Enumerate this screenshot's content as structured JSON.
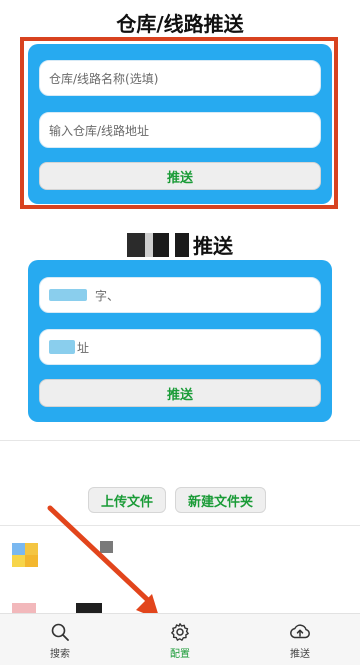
{
  "section1": {
    "title": "仓库/线路推送",
    "name_placeholder": "仓库/线路名称(选填)",
    "address_placeholder": "输入仓库/线路地址",
    "push_label": "推送"
  },
  "section2": {
    "title": "推送",
    "field1_text": "字、",
    "field2_text": "址",
    "push_label": "推送"
  },
  "file_actions": {
    "upload_label": "上传文件",
    "new_folder_label": "新建文件夹"
  },
  "bottom_nav": {
    "search_label": "搜索",
    "config_label": "配置",
    "push_label": "推送"
  },
  "colors": {
    "card_blue": "#27aaf0",
    "highlight_red": "#d8421f",
    "action_green": "#1a9b37",
    "arrow_orange": "#e2451c"
  },
  "icons": [
    "search-icon",
    "gear-icon",
    "cloud-upload-icon"
  ]
}
